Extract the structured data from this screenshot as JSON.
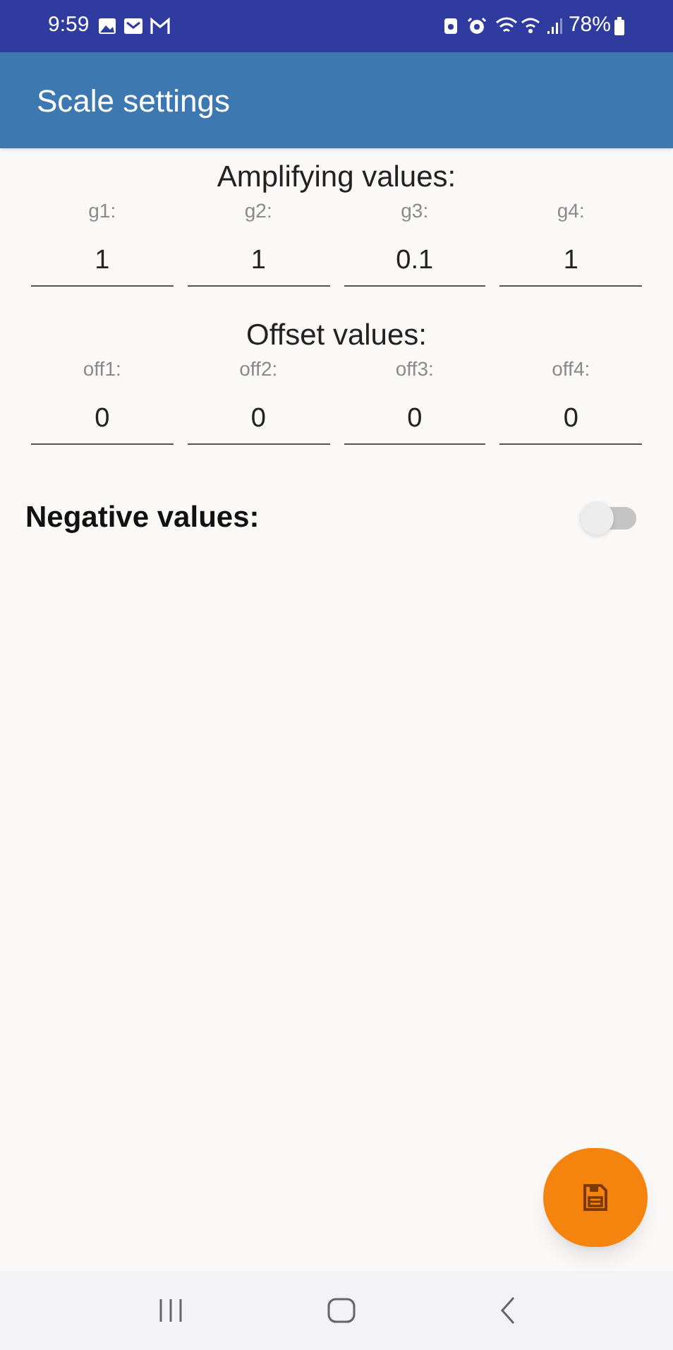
{
  "status_bar": {
    "time": "9:59",
    "battery": "78%"
  },
  "app_bar": {
    "title": "Scale settings"
  },
  "sections": [
    {
      "title": "Amplifying values:",
      "fields": [
        {
          "label": "g1:",
          "value": "1"
        },
        {
          "label": "g2:",
          "value": "1"
        },
        {
          "label": "g3:",
          "value": "0.1"
        },
        {
          "label": "g4:",
          "value": "1"
        }
      ]
    },
    {
      "title": "Offset values:",
      "fields": [
        {
          "label": "off1:",
          "value": "0"
        },
        {
          "label": "off2:",
          "value": "0"
        },
        {
          "label": "off3:",
          "value": "0"
        },
        {
          "label": "off4:",
          "value": "0"
        }
      ]
    }
  ],
  "negative_values": {
    "label": "Negative values:",
    "on": false
  }
}
